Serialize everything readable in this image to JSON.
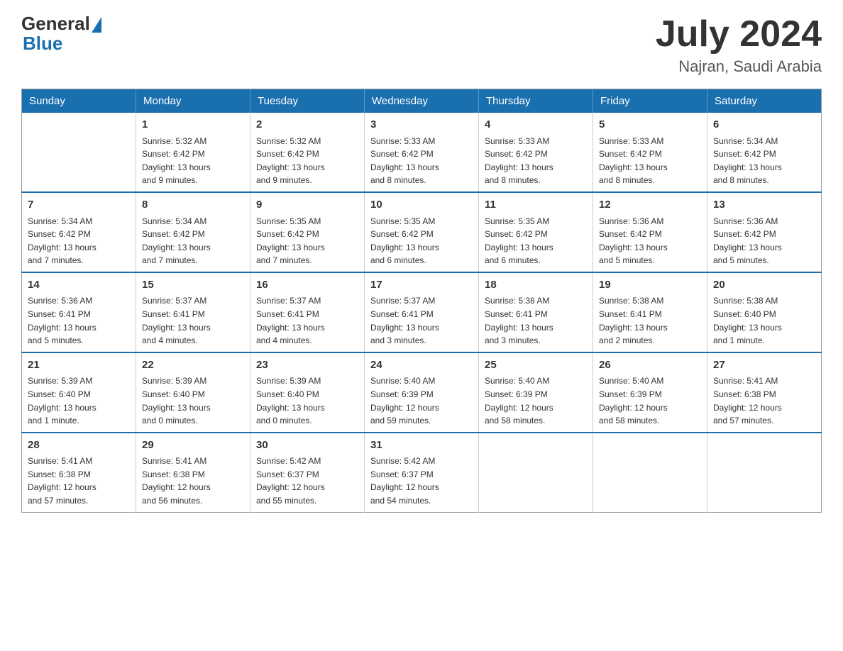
{
  "logo": {
    "general": "General",
    "blue": "Blue"
  },
  "title": "July 2024",
  "location": "Najran, Saudi Arabia",
  "days_of_week": [
    "Sunday",
    "Monday",
    "Tuesday",
    "Wednesday",
    "Thursday",
    "Friday",
    "Saturday"
  ],
  "weeks": [
    [
      {
        "day": "",
        "info": ""
      },
      {
        "day": "1",
        "info": "Sunrise: 5:32 AM\nSunset: 6:42 PM\nDaylight: 13 hours\nand 9 minutes."
      },
      {
        "day": "2",
        "info": "Sunrise: 5:32 AM\nSunset: 6:42 PM\nDaylight: 13 hours\nand 9 minutes."
      },
      {
        "day": "3",
        "info": "Sunrise: 5:33 AM\nSunset: 6:42 PM\nDaylight: 13 hours\nand 8 minutes."
      },
      {
        "day": "4",
        "info": "Sunrise: 5:33 AM\nSunset: 6:42 PM\nDaylight: 13 hours\nand 8 minutes."
      },
      {
        "day": "5",
        "info": "Sunrise: 5:33 AM\nSunset: 6:42 PM\nDaylight: 13 hours\nand 8 minutes."
      },
      {
        "day": "6",
        "info": "Sunrise: 5:34 AM\nSunset: 6:42 PM\nDaylight: 13 hours\nand 8 minutes."
      }
    ],
    [
      {
        "day": "7",
        "info": "Sunrise: 5:34 AM\nSunset: 6:42 PM\nDaylight: 13 hours\nand 7 minutes."
      },
      {
        "day": "8",
        "info": "Sunrise: 5:34 AM\nSunset: 6:42 PM\nDaylight: 13 hours\nand 7 minutes."
      },
      {
        "day": "9",
        "info": "Sunrise: 5:35 AM\nSunset: 6:42 PM\nDaylight: 13 hours\nand 7 minutes."
      },
      {
        "day": "10",
        "info": "Sunrise: 5:35 AM\nSunset: 6:42 PM\nDaylight: 13 hours\nand 6 minutes."
      },
      {
        "day": "11",
        "info": "Sunrise: 5:35 AM\nSunset: 6:42 PM\nDaylight: 13 hours\nand 6 minutes."
      },
      {
        "day": "12",
        "info": "Sunrise: 5:36 AM\nSunset: 6:42 PM\nDaylight: 13 hours\nand 5 minutes."
      },
      {
        "day": "13",
        "info": "Sunrise: 5:36 AM\nSunset: 6:42 PM\nDaylight: 13 hours\nand 5 minutes."
      }
    ],
    [
      {
        "day": "14",
        "info": "Sunrise: 5:36 AM\nSunset: 6:41 PM\nDaylight: 13 hours\nand 5 minutes."
      },
      {
        "day": "15",
        "info": "Sunrise: 5:37 AM\nSunset: 6:41 PM\nDaylight: 13 hours\nand 4 minutes."
      },
      {
        "day": "16",
        "info": "Sunrise: 5:37 AM\nSunset: 6:41 PM\nDaylight: 13 hours\nand 4 minutes."
      },
      {
        "day": "17",
        "info": "Sunrise: 5:37 AM\nSunset: 6:41 PM\nDaylight: 13 hours\nand 3 minutes."
      },
      {
        "day": "18",
        "info": "Sunrise: 5:38 AM\nSunset: 6:41 PM\nDaylight: 13 hours\nand 3 minutes."
      },
      {
        "day": "19",
        "info": "Sunrise: 5:38 AM\nSunset: 6:41 PM\nDaylight: 13 hours\nand 2 minutes."
      },
      {
        "day": "20",
        "info": "Sunrise: 5:38 AM\nSunset: 6:40 PM\nDaylight: 13 hours\nand 1 minute."
      }
    ],
    [
      {
        "day": "21",
        "info": "Sunrise: 5:39 AM\nSunset: 6:40 PM\nDaylight: 13 hours\nand 1 minute."
      },
      {
        "day": "22",
        "info": "Sunrise: 5:39 AM\nSunset: 6:40 PM\nDaylight: 13 hours\nand 0 minutes."
      },
      {
        "day": "23",
        "info": "Sunrise: 5:39 AM\nSunset: 6:40 PM\nDaylight: 13 hours\nand 0 minutes."
      },
      {
        "day": "24",
        "info": "Sunrise: 5:40 AM\nSunset: 6:39 PM\nDaylight: 12 hours\nand 59 minutes."
      },
      {
        "day": "25",
        "info": "Sunrise: 5:40 AM\nSunset: 6:39 PM\nDaylight: 12 hours\nand 58 minutes."
      },
      {
        "day": "26",
        "info": "Sunrise: 5:40 AM\nSunset: 6:39 PM\nDaylight: 12 hours\nand 58 minutes."
      },
      {
        "day": "27",
        "info": "Sunrise: 5:41 AM\nSunset: 6:38 PM\nDaylight: 12 hours\nand 57 minutes."
      }
    ],
    [
      {
        "day": "28",
        "info": "Sunrise: 5:41 AM\nSunset: 6:38 PM\nDaylight: 12 hours\nand 57 minutes."
      },
      {
        "day": "29",
        "info": "Sunrise: 5:41 AM\nSunset: 6:38 PM\nDaylight: 12 hours\nand 56 minutes."
      },
      {
        "day": "30",
        "info": "Sunrise: 5:42 AM\nSunset: 6:37 PM\nDaylight: 12 hours\nand 55 minutes."
      },
      {
        "day": "31",
        "info": "Sunrise: 5:42 AM\nSunset: 6:37 PM\nDaylight: 12 hours\nand 54 minutes."
      },
      {
        "day": "",
        "info": ""
      },
      {
        "day": "",
        "info": ""
      },
      {
        "day": "",
        "info": ""
      }
    ]
  ]
}
